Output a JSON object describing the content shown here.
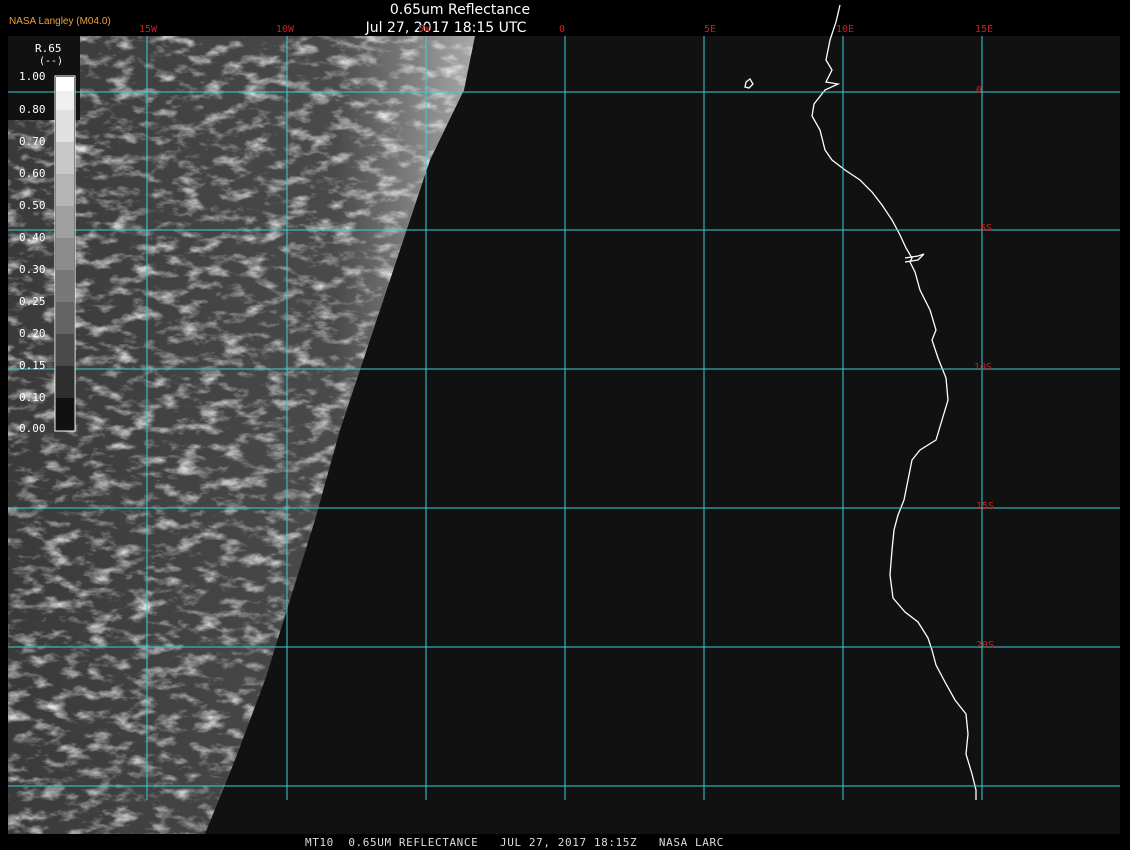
{
  "title": "0.65um Reflectance",
  "timestamp": "Jul 27, 2017 18:15 UTC",
  "agency": "NASA Langley (M04.0)",
  "footer": "MT10  0.65UM REFLECTANCE   JUL 27, 2017 18:15Z   NASA LARC",
  "colorbar": {
    "variable": "R.65",
    "units": "(--)",
    "ticks": [
      "1.00",
      "0.80",
      "0.70",
      "0.60",
      "0.50",
      "0.40",
      "0.30",
      "0.25",
      "0.20",
      "0.15",
      "0.10",
      "0.00"
    ]
  },
  "longitude_labels": [
    "15W",
    "10W",
    "5W",
    "0",
    "5E",
    "10E",
    "15E"
  ],
  "latitude_labels": [
    "0",
    "5S",
    "10S",
    "15S",
    "20S"
  ],
  "colors": {
    "grid": "#38cfd6",
    "grid_label": "#cc1f1f",
    "coastline": "#ffffff",
    "space": "#111111"
  }
}
